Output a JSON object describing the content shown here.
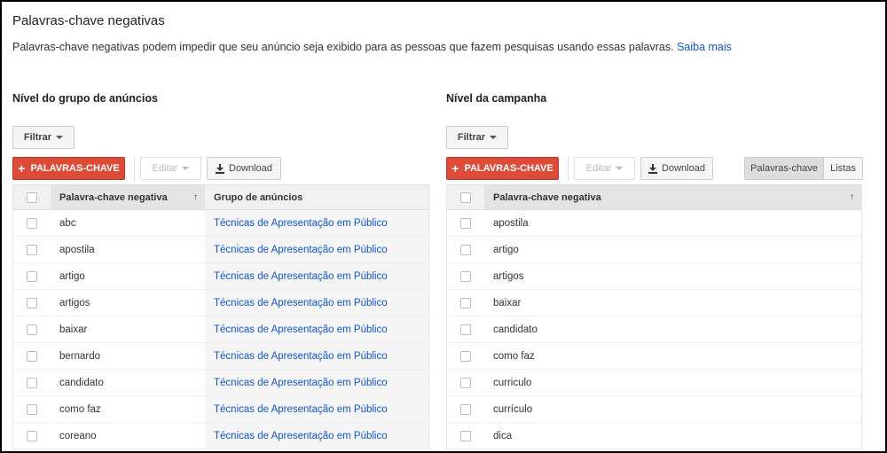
{
  "page": {
    "title": "Palavras-chave negativas",
    "description": "Palavras-chave negativas podem impedir que seu anúncio seja exibido para as pessoas que fazem pesquisas usando essas palavras.",
    "learn_more": "Saiba mais"
  },
  "adgroup": {
    "title": "Nível do grupo de anúncios",
    "filter_label": "Filtrar",
    "add_label": "PALAVRAS-CHAVE",
    "edit_label": "Editar",
    "download_label": "Download",
    "col_keyword": "Palavra-chave negativa",
    "col_group": "Grupo de anúncios",
    "sort_arrow": "↑",
    "rows": [
      {
        "keyword": "abc",
        "group": "Técnicas de Apresentação em Público"
      },
      {
        "keyword": "apostila",
        "group": "Técnicas de Apresentação em Público"
      },
      {
        "keyword": "artigo",
        "group": "Técnicas de Apresentação em Público"
      },
      {
        "keyword": "artigos",
        "group": "Técnicas de Apresentação em Público"
      },
      {
        "keyword": "baixar",
        "group": "Técnicas de Apresentação em Público"
      },
      {
        "keyword": "bernardo",
        "group": "Técnicas de Apresentação em Público"
      },
      {
        "keyword": "candidato",
        "group": "Técnicas de Apresentação em Público"
      },
      {
        "keyword": "como faz",
        "group": "Técnicas de Apresentação em Público"
      },
      {
        "keyword": "coreano",
        "group": "Técnicas de Apresentação em Público"
      }
    ]
  },
  "campaign": {
    "title": "Nível da campanha",
    "filter_label": "Filtrar",
    "add_label": "PALAVRAS-CHAVE",
    "edit_label": "Editar",
    "download_label": "Download",
    "toggle_keywords": "Palavras-chave",
    "toggle_lists": "Listas",
    "col_keyword": "Palavra-chave negativa",
    "sort_arrow": "↑",
    "rows": [
      {
        "keyword": "apostila"
      },
      {
        "keyword": "artigo"
      },
      {
        "keyword": "artigos"
      },
      {
        "keyword": "baixar"
      },
      {
        "keyword": "candidato"
      },
      {
        "keyword": "como faz"
      },
      {
        "keyword": "curriculo"
      },
      {
        "keyword": "currículo"
      },
      {
        "keyword": "dica"
      }
    ]
  },
  "colors": {
    "accent_red": "#dd4b39",
    "link_blue": "#1155cc"
  },
  "icons": {
    "add": "plus-icon",
    "dropdown": "caret-down-icon",
    "download": "download-icon",
    "sort": "sort-up-icon"
  }
}
